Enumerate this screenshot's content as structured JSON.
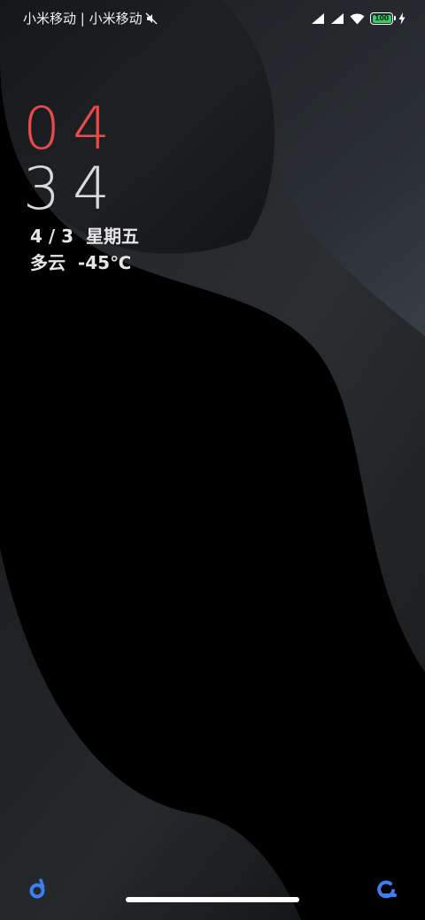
{
  "status_bar": {
    "carrier_text": "小米移动 | 小米移动",
    "battery_level": "100",
    "icons": [
      "mute-icon",
      "signal-icon",
      "signal-icon",
      "wifi-icon",
      "battery-icon",
      "charging-bolt-icon"
    ]
  },
  "clock": {
    "hours": "04",
    "minutes": "34"
  },
  "date": {
    "text": "4 / 3  星期五"
  },
  "weather": {
    "text": "多云  -45℃"
  },
  "shortcuts": {
    "left_icon": "voice-assistant-icon",
    "right_icon": "camera-shortcut-icon"
  },
  "colors": {
    "hours": "#e84b4b",
    "minutes": "#d9d9d9",
    "accent_blue": "#3d7ef0",
    "battery_green": "#38c96a"
  }
}
